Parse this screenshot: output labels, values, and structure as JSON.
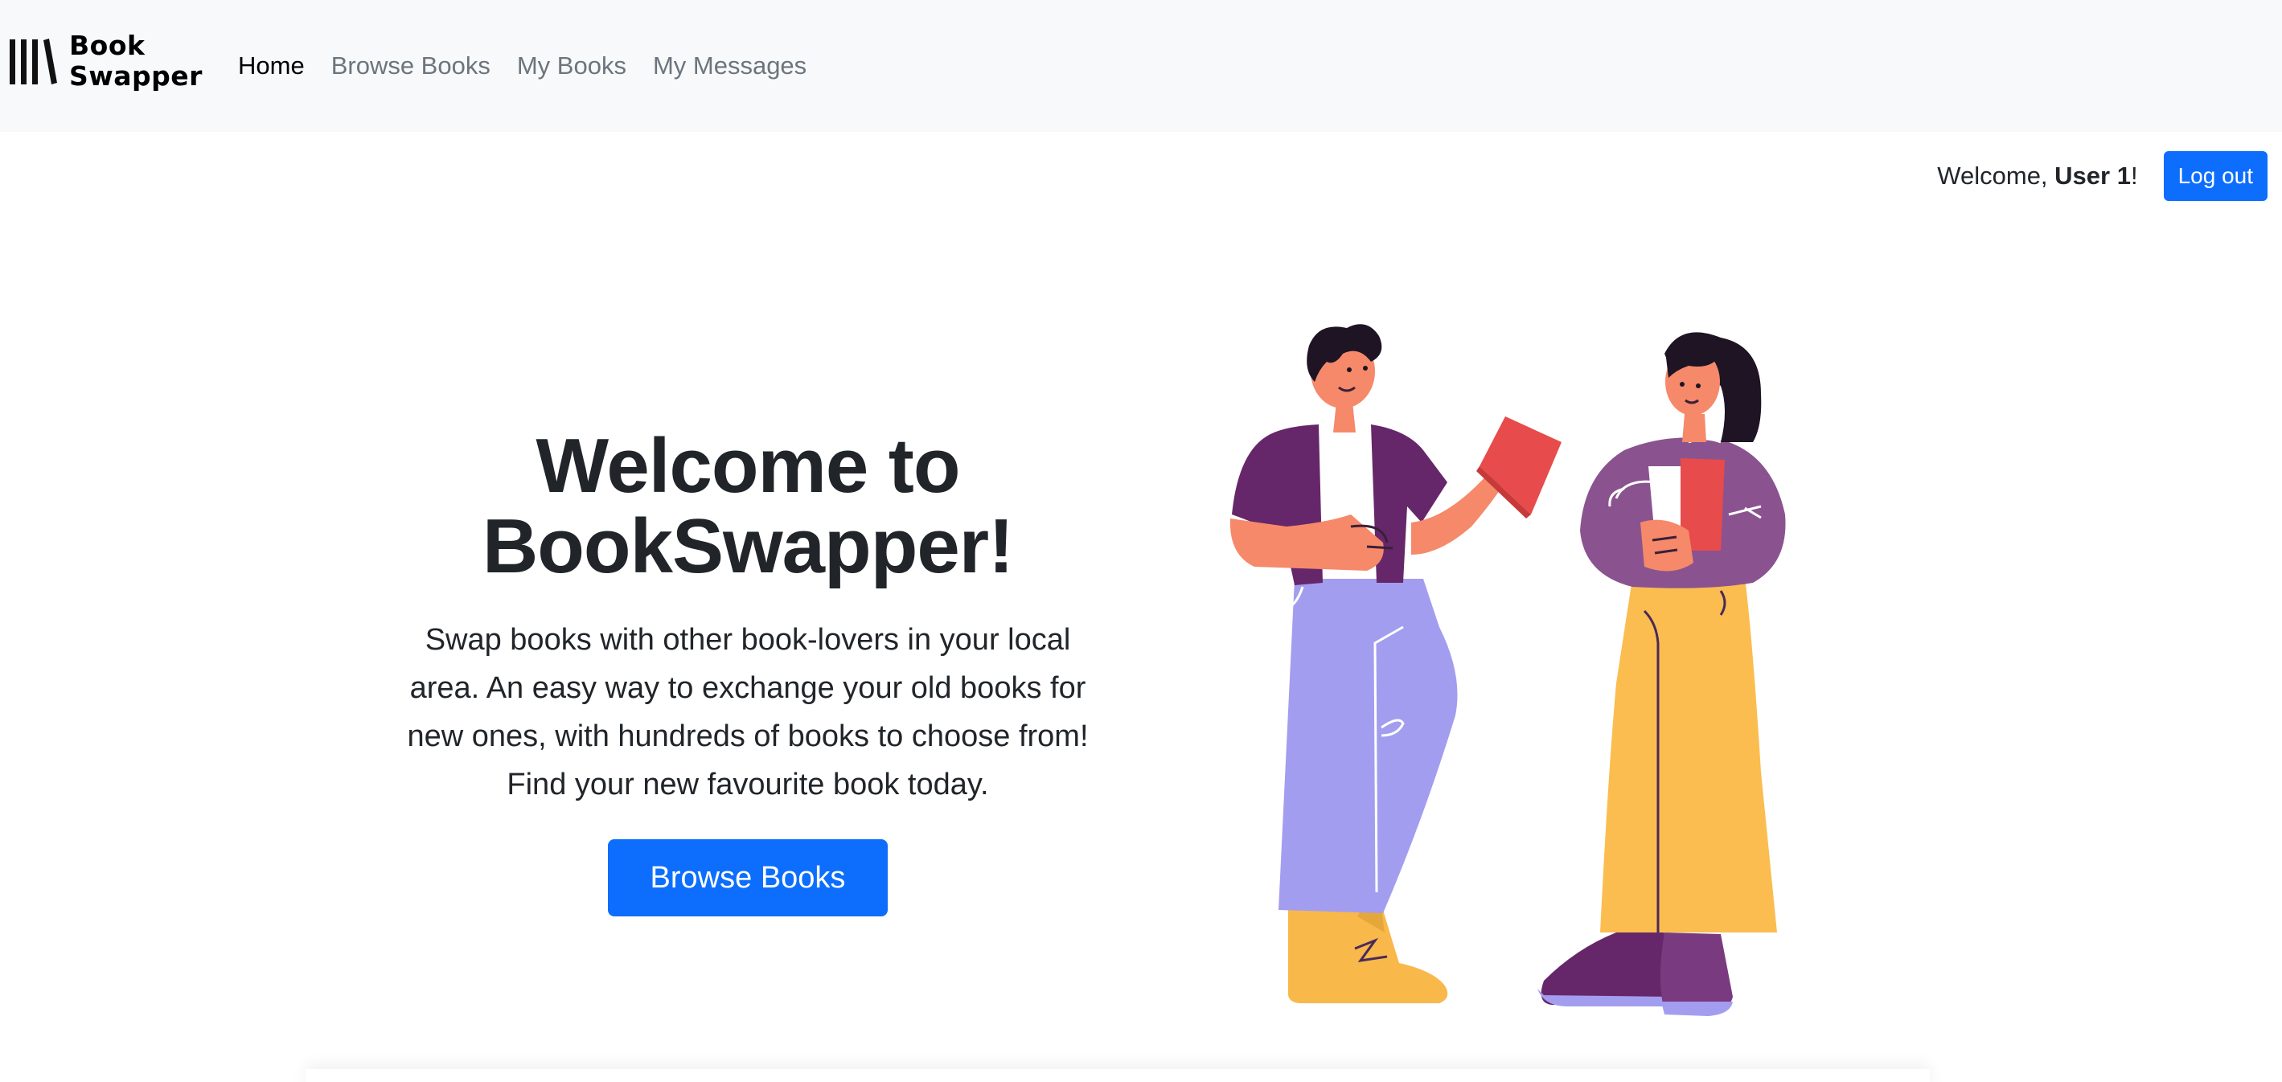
{
  "brand": {
    "line1": "Book",
    "line2": "Swapper"
  },
  "nav": {
    "items": [
      {
        "label": "Home",
        "active": true
      },
      {
        "label": "Browse Books",
        "active": false
      },
      {
        "label": "My Books",
        "active": false
      },
      {
        "label": "My Messages",
        "active": false
      }
    ]
  },
  "user": {
    "welcome_prefix": "Welcome, ",
    "name": "User 1",
    "welcome_suffix": "!",
    "logout_label": "Log out"
  },
  "hero": {
    "title_line1": "Welcome to",
    "title_line2": "BookSwapper!",
    "description": "Swap books with other book-lovers in your local area. An easy way to exchange your old books for new ones, with hundreds of books to choose from! Find your new favourite book today.",
    "cta_label": "Browse Books"
  },
  "colors": {
    "primary": "#0d6efd",
    "navbar_bg": "#f8f9fa",
    "text": "#212529",
    "muted": "#6c757d"
  },
  "icons": {
    "brand_logo": "books-logo-icon",
    "illustration": "people-swapping-books-illustration"
  }
}
